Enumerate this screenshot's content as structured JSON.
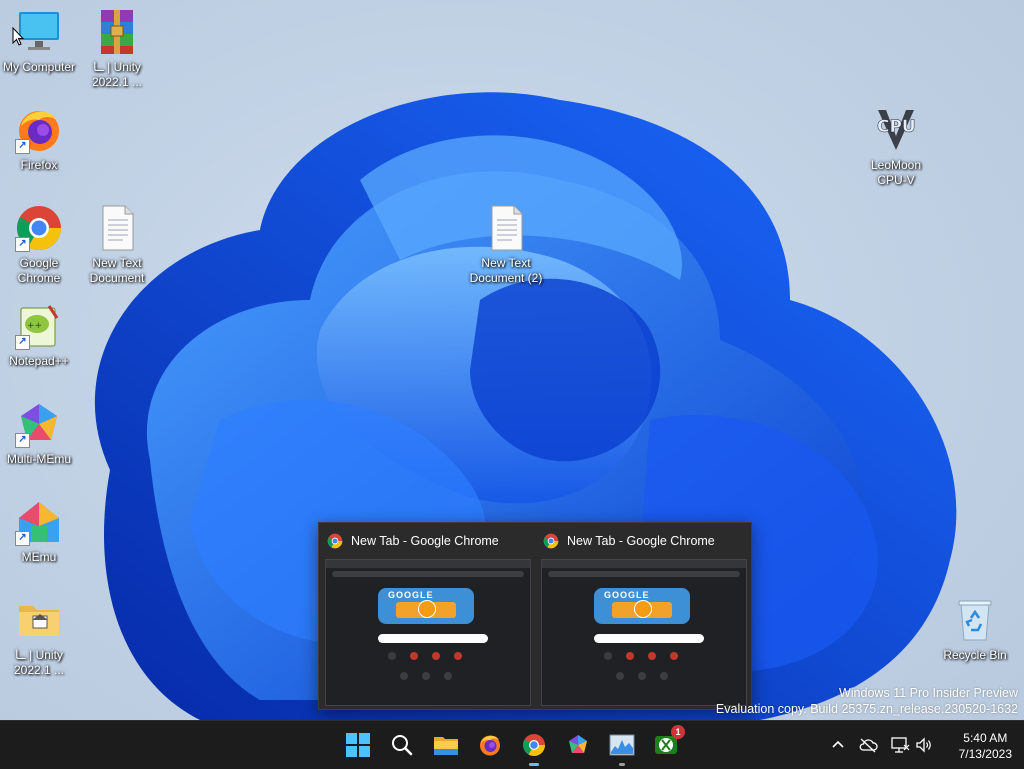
{
  "desktop": {
    "icons": [
      {
        "label": "My Computer"
      },
      {
        "label": "ــا | Unity 2022.1 ..."
      },
      {
        "label": "Firefox"
      },
      {
        "label": "Google Chrome"
      },
      {
        "label": "New Text Document"
      },
      {
        "label": "Notepad++"
      },
      {
        "label": "Multi-MEmu"
      },
      {
        "label": "MEmu"
      },
      {
        "label": "ــا | Unity 2022.1 ..."
      },
      {
        "label": "New Text Document (2)"
      },
      {
        "label": "LeoMoon CPU-V"
      },
      {
        "label": "Recycle Bin"
      }
    ],
    "cpu_logo_text": "CPU"
  },
  "thumbnail_popup": {
    "windows": [
      {
        "title": "New Tab - Google Chrome",
        "doodle_text": "GOOGLE"
      },
      {
        "title": "New Tab - Google Chrome",
        "doodle_text": "GOOGLE"
      }
    ]
  },
  "watermark": {
    "line1": "Windows 11 Pro Insider Preview",
    "line2": "Evaluation copy. Build 25375.zn_release.230520-1632"
  },
  "taskbar": {
    "apps": [
      {
        "name": "start-button",
        "icon": "windows-logo-icon"
      },
      {
        "name": "search-button",
        "icon": "search-icon"
      },
      {
        "name": "file-explorer-button",
        "icon": "folder-icon"
      },
      {
        "name": "firefox-button",
        "icon": "firefox-icon"
      },
      {
        "name": "chrome-button",
        "icon": "chrome-icon",
        "running": true
      },
      {
        "name": "multi-memu-button",
        "icon": "memu-icon"
      },
      {
        "name": "task-manager-button",
        "icon": "chart-icon"
      },
      {
        "name": "xbox-button",
        "icon": "xbox-icon",
        "badge": "1"
      }
    ],
    "clock": {
      "time": "5:40 AM",
      "date": "7/13/2023"
    },
    "colors": {
      "accent": "#76b9ed",
      "badge": "#d13438",
      "bar": "#1c1c1c"
    }
  }
}
